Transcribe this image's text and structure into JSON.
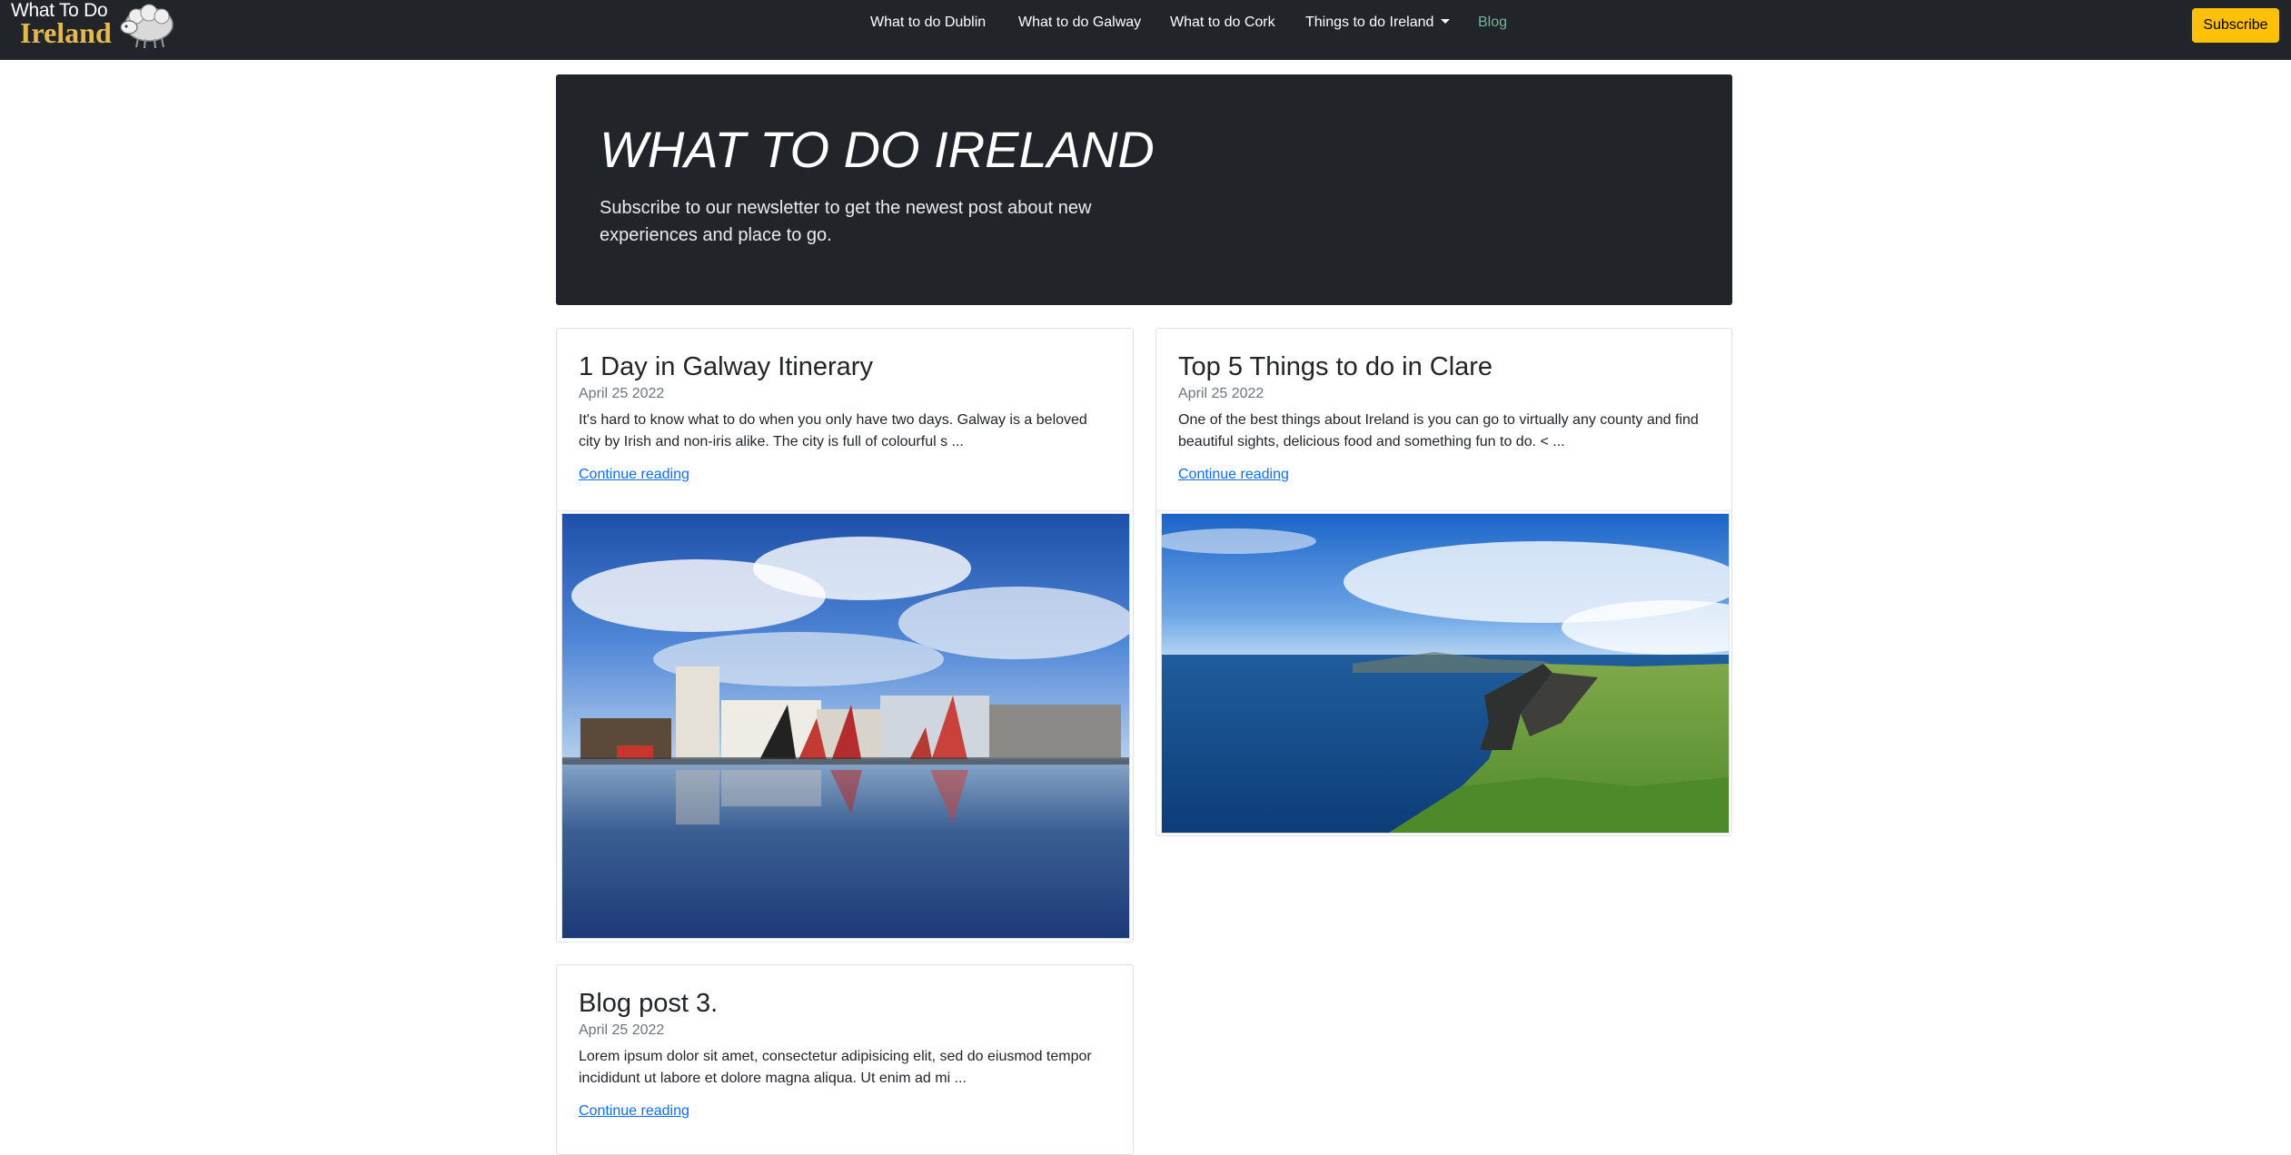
{
  "brand": {
    "line1": "What To Do",
    "line2": "Ireland",
    "accent": "#e4b94c"
  },
  "nav": {
    "links": [
      {
        "label": "What to do Dublin"
      },
      {
        "label": "What to do Galway"
      },
      {
        "label": "What to do Cork"
      },
      {
        "label": "Things to do Ireland"
      },
      {
        "label": "Blog"
      }
    ],
    "subscribe_label": "Subscribe",
    "subscribe_color": "#ffc107",
    "active_color": "#75b798"
  },
  "hero": {
    "title": "WHAT TO DO IRELAND",
    "text": "Subscribe to our newsletter to get the newest post about new experiences and place to go."
  },
  "posts": [
    {
      "title": "1 Day in Galway Itinerary",
      "date": "April 25 2022",
      "excerpt": "It's hard to know what to do when you only have two days. Galway is a beloved city by Irish and non-iris alike. The city is full of colourful s ...",
      "link": "Continue reading"
    },
    {
      "title": "Top 5 Things to do in Clare",
      "date": "April 25 2022",
      "excerpt": "One of the best things about Ireland is you can go to virtually any county and find beautiful sights, delicious food and something fun to do. < ...",
      "link": "Continue reading"
    },
    {
      "title": "Blog post 3.",
      "date": "April 25 2022",
      "excerpt": "Lorem ipsum dolor sit amet, consectetur adipisicing elit, sed do eiusmod tempor incididunt ut labore et dolore magna aliqua. Ut enim ad mi ...",
      "link": "Continue reading"
    }
  ]
}
